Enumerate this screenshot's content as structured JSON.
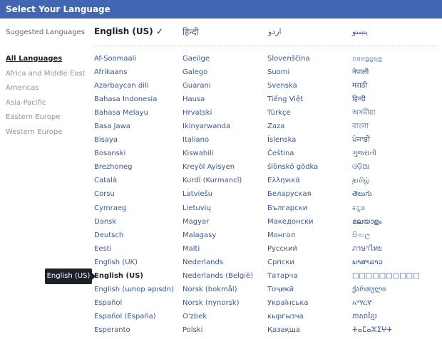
{
  "header": {
    "title": "Select Your Language"
  },
  "suggested": {
    "label": "Suggested Languages",
    "items": [
      {
        "label": "English (US) ✓",
        "current": true
      },
      {
        "label": "हिन्दी"
      },
      {
        "label": "اردو"
      },
      {
        "label": "پښتو"
      }
    ]
  },
  "regions": [
    {
      "label": "All Languages",
      "active": true
    },
    {
      "label": "Africa and Middle East"
    },
    {
      "label": "Americas"
    },
    {
      "label": "Asia-Pacific"
    },
    {
      "label": "Eastern Europe"
    },
    {
      "label": "Western Europe"
    }
  ],
  "columns": [
    [
      "Af-Soomaali",
      "Afrikaans",
      "Azərbaycan dili",
      "Bahasa Indonesia",
      "Bahasa Melayu",
      "Basa Jawa",
      "Bisaya",
      "Bosanski",
      "Brezhoneg",
      "Català",
      "Corsu",
      "Cymraeg",
      "Dansk",
      "Deutsch",
      "Eesti",
      "English (UK)",
      "English (US)",
      "English (ɯnop əpısdn)",
      "Español",
      "Español (España)",
      "Esperanto"
    ],
    [
      "Gaeilge",
      "Galego",
      "Guarani",
      "Hausa",
      "Hrvatski",
      "Ikinyarwanda",
      "Italiano",
      "Kiswahili",
      "Kreyòl Ayisyen",
      "Kurdî (Kurmancî)",
      "Latviešu",
      "Lietuvių",
      "Magyar",
      "Malagasy",
      "Malti",
      "Nederlands",
      "Nederlands (België)",
      "Norsk (bokmål)",
      "Norsk (nynorsk)",
      "O'zbek",
      "Polski"
    ],
    [
      "Slovenščina",
      "Suomi",
      "Svenska",
      "Tiếng Việt",
      "Türkçe",
      "Zaza",
      "Íslenska",
      "Čeština",
      "ślōnskŏ gŏdka",
      "Ελληνικά",
      "Беларуская",
      "Български",
      "Македонски",
      "Монгол",
      "Русский",
      "Српски",
      "Татарча",
      "Тоҷикӣ",
      "Українська",
      "кыргызча",
      "Қазақша"
    ],
    [
      "ꤊꤢꤛꤢ꤭ꤜꤟꤤ꤬",
      "नेपाली",
      "मराठी",
      "हिन्दी",
      "অসমীয়া",
      "বাংলা",
      "ਪੰਜਾਬੀ",
      "ગુજરાતી",
      "ଓଡ଼ିଆ",
      "தமிழ்",
      "తెలుగు",
      "ಕನ್ನಡ",
      "മലയാളം",
      "සිංහල",
      "ภาษาไทย",
      "ພາສາລາວ",
      "□□□□□□□□□□",
      "ქართული",
      "አማርኛ",
      "ភាសាខ្មែរ",
      "ⵜⴰⵎⴰⵣⵉⵖⵜ"
    ]
  ],
  "selected_language": "English (US)",
  "tooltip": {
    "text": "English (US)"
  }
}
